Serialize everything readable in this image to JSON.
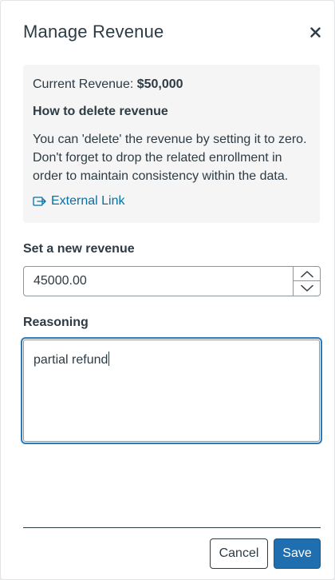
{
  "dialog": {
    "title": "Manage Revenue",
    "close_icon": "close-icon"
  },
  "info": {
    "current_label": "Current Revenue: ",
    "current_value": "$50,000",
    "heading": "How to delete revenue",
    "body": "You can 'delete' the revenue by setting it to zero. Don't forget to drop the related enrollment in order to maintain consistency within the data.",
    "link_label": "External Link",
    "link_icon": "external-link-icon"
  },
  "revenue_field": {
    "label": "Set a new revenue",
    "value": "45000.00",
    "step_up_icon": "chevron-up-icon",
    "step_down_icon": "chevron-down-icon"
  },
  "reasoning_field": {
    "label": "Reasoning",
    "value": "partial refund"
  },
  "footer": {
    "cancel_label": "Cancel",
    "save_label": "Save"
  },
  "colors": {
    "link": "#0770a3",
    "primary": "#1f6fb0",
    "focus_ring": "#2b7abc",
    "text": "#2d3b45",
    "panel_bg": "#f5f5f5"
  }
}
